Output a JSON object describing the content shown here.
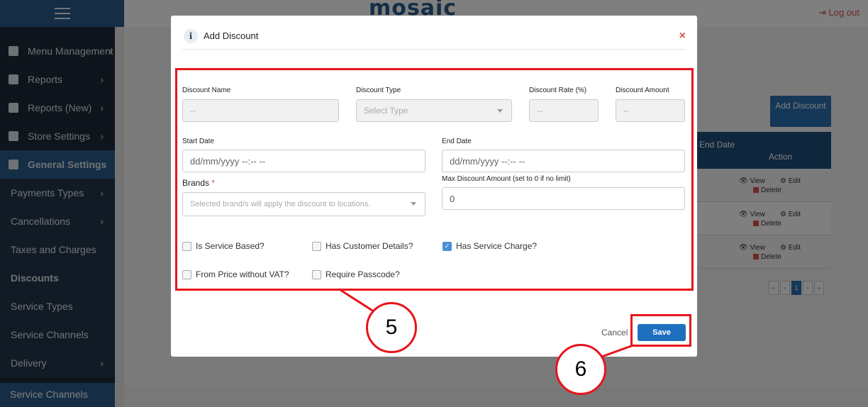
{
  "app": {
    "logo": "mosaic",
    "logout": "Log out"
  },
  "sidebar": {
    "items": [
      {
        "label": "Menu Management"
      },
      {
        "label": "Reports"
      },
      {
        "label": "Reports (New)"
      },
      {
        "label": "Store Settings"
      },
      {
        "label": "General Settings"
      }
    ],
    "sub_items": [
      {
        "label": "Payments Types"
      },
      {
        "label": "Cancellations"
      },
      {
        "label": "Taxes and Charges"
      },
      {
        "label": "Discounts"
      },
      {
        "label": "Service Types"
      },
      {
        "label": "Service Channels"
      },
      {
        "label": "Delivery"
      }
    ],
    "bottom_item": "Service Channels"
  },
  "background": {
    "add_button": "Add Discount",
    "table": {
      "col_end_date": "End Date",
      "col_action": "Action",
      "view": "View",
      "edit": "Edit",
      "delete": "Delete"
    },
    "pager": [
      "«",
      "‹",
      "1",
      "›",
      "»"
    ]
  },
  "modal": {
    "title": "Add Discount",
    "fields": {
      "discount_name": {
        "label": "Discount Name",
        "placeholder": "--"
      },
      "discount_type": {
        "label": "Discount Type",
        "placeholder": "Select Type"
      },
      "discount_rate": {
        "label": "Discount Rate (%)",
        "placeholder": "--"
      },
      "discount_amount": {
        "label": "Discount Amount",
        "placeholder": "--"
      },
      "start_date": {
        "label": "Start Date",
        "placeholder": "dd/mm/yyyy --:-- --"
      },
      "end_date": {
        "label": "End Date",
        "placeholder": "dd/mm/yyyy --:-- --"
      },
      "brands": {
        "label": "Brands",
        "required": "*",
        "placeholder": "Selected brand/s will apply the discount to locations."
      },
      "max_discount": {
        "label": "Max Discount Amount (set to 0 if no limit)",
        "value": "0"
      }
    },
    "checkboxes": [
      {
        "label": "Is Service Based?",
        "checked": false
      },
      {
        "label": "Has Customer Details?",
        "checked": false
      },
      {
        "label": "Has Service Charge?",
        "checked": true
      },
      {
        "label": "From Price without VAT?",
        "checked": false
      },
      {
        "label": "Require Passcode?",
        "checked": false
      }
    ],
    "cancel_label": "Cancel",
    "save_label": "Save"
  },
  "annotations": {
    "step5": "5",
    "step6": "6",
    "highlight_color": "#e8141c"
  }
}
